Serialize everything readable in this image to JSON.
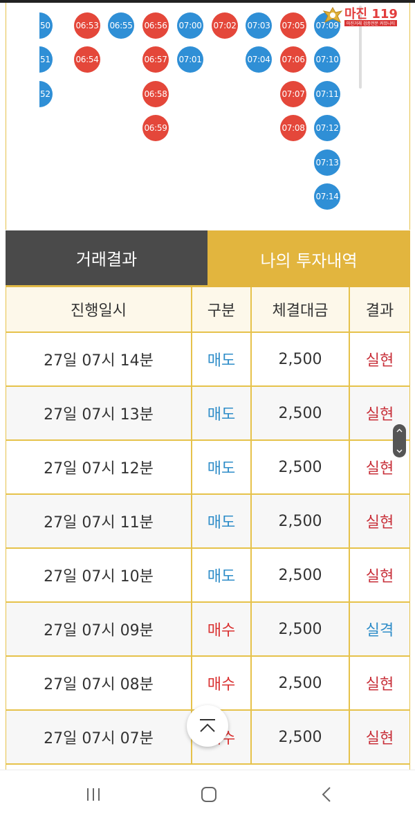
{
  "board": {
    "beads": [
      {
        "t": "50",
        "c": "blue",
        "col": 0,
        "row": 0,
        "partial": true
      },
      {
        "t": "51",
        "c": "blue",
        "col": 0,
        "row": 1,
        "partial": true
      },
      {
        "t": "52",
        "c": "blue",
        "col": 0,
        "row": 2,
        "partial": true
      },
      {
        "t": "06:53",
        "c": "red",
        "col": 1,
        "row": 0
      },
      {
        "t": "06:54",
        "c": "red",
        "col": 1,
        "row": 1
      },
      {
        "t": "06:55",
        "c": "blue",
        "col": 2,
        "row": 0
      },
      {
        "t": "06:56",
        "c": "red",
        "col": 3,
        "row": 0
      },
      {
        "t": "06:57",
        "c": "red",
        "col": 3,
        "row": 1
      },
      {
        "t": "06:58",
        "c": "red",
        "col": 3,
        "row": 2
      },
      {
        "t": "06:59",
        "c": "red",
        "col": 3,
        "row": 3
      },
      {
        "t": "07:00",
        "c": "blue",
        "col": 4,
        "row": 0
      },
      {
        "t": "07:01",
        "c": "blue",
        "col": 4,
        "row": 1
      },
      {
        "t": "07:02",
        "c": "red",
        "col": 5,
        "row": 0
      },
      {
        "t": "07:03",
        "c": "blue",
        "col": 6,
        "row": 0
      },
      {
        "t": "07:04",
        "c": "blue",
        "col": 6,
        "row": 1
      },
      {
        "t": "07:05",
        "c": "red",
        "col": 7,
        "row": 0
      },
      {
        "t": "07:06",
        "c": "red",
        "col": 7,
        "row": 1
      },
      {
        "t": "07:07",
        "c": "red",
        "col": 7,
        "row": 2
      },
      {
        "t": "07:08",
        "c": "red",
        "col": 7,
        "row": 3
      },
      {
        "t": "07:09",
        "c": "blue",
        "col": 8,
        "row": 0
      },
      {
        "t": "07:10",
        "c": "blue",
        "col": 8,
        "row": 1
      },
      {
        "t": "07:11",
        "c": "blue",
        "col": 8,
        "row": 2
      },
      {
        "t": "07:12",
        "c": "blue",
        "col": 8,
        "row": 3
      },
      {
        "t": "07:13",
        "c": "blue",
        "col": 8,
        "row": 4
      },
      {
        "t": "07:14",
        "c": "blue",
        "col": 8,
        "row": 5
      }
    ]
  },
  "watermark": {
    "title": "마진 119",
    "subtitle": "마진거래 검증전문 커뮤니티"
  },
  "tabs": {
    "results": "거래결과",
    "my_history": "나의 투자내역"
  },
  "table": {
    "headers": {
      "datetime": "진행일시",
      "type": "구분",
      "amount": "체결대금",
      "result": "결과"
    },
    "rows": [
      {
        "datetime": "27일 07시 14분",
        "type": "매도",
        "amount": "2,500",
        "result": "실현"
      },
      {
        "datetime": "27일 07시 13분",
        "type": "매도",
        "amount": "2,500",
        "result": "실현"
      },
      {
        "datetime": "27일 07시 12분",
        "type": "매도",
        "amount": "2,500",
        "result": "실현"
      },
      {
        "datetime": "27일 07시 11분",
        "type": "매도",
        "amount": "2,500",
        "result": "실현"
      },
      {
        "datetime": "27일 07시 10분",
        "type": "매도",
        "amount": "2,500",
        "result": "실현"
      },
      {
        "datetime": "27일 07시 09분",
        "type": "매수",
        "amount": "2,500",
        "result": "실격"
      },
      {
        "datetime": "27일 07시 08분",
        "type": "매수",
        "amount": "2,500",
        "result": "실현"
      },
      {
        "datetime": "27일 07시 07분",
        "type": "매수",
        "amount": "2,500",
        "result": "실현"
      }
    ]
  },
  "colors": {
    "sell": "#2d8cc8",
    "buy": "#d93030",
    "win": "#c8303a",
    "lose": "#2d8cc8",
    "accent": "#e2b53e",
    "dark_tab": "#4a4a4a"
  },
  "icons": {
    "scroll_top": "chevron-up-bar-icon",
    "nav_recent": "recent-apps-icon",
    "nav_home": "home-icon",
    "nav_back": "back-icon"
  }
}
